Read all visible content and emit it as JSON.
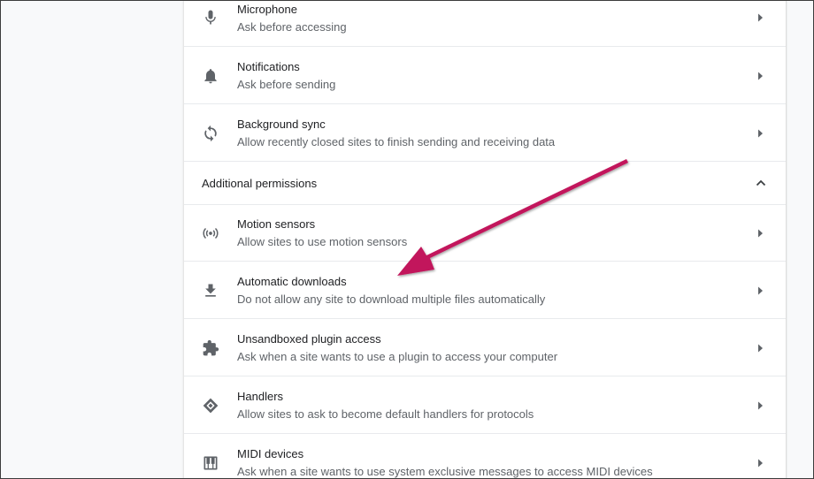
{
  "permissions": {
    "items_top": [
      {
        "key": "microphone",
        "title": "Microphone",
        "subtitle": "Ask before accessing",
        "icon": "microphone-icon"
      },
      {
        "key": "notifications",
        "title": "Notifications",
        "subtitle": "Ask before sending",
        "icon": "bell-icon"
      },
      {
        "key": "background-sync",
        "title": "Background sync",
        "subtitle": "Allow recently closed sites to finish sending and receiving data",
        "icon": "sync-icon"
      }
    ],
    "additional": {
      "label": "Additional permissions",
      "expanded": true,
      "chevron_icon": "chevron-up-icon"
    },
    "items_additional": [
      {
        "key": "motion-sensors",
        "title": "Motion sensors",
        "subtitle": "Allow sites to use motion sensors",
        "icon": "sensors-icon"
      },
      {
        "key": "automatic-downloads",
        "title": "Automatic downloads",
        "subtitle": "Do not allow any site to download multiple files automatically",
        "icon": "download-icon"
      },
      {
        "key": "unsandboxed-plugin",
        "title": "Unsandboxed plugin access",
        "subtitle": "Ask when a site wants to use a plugin to access your computer",
        "icon": "puzzle-icon"
      },
      {
        "key": "handlers",
        "title": "Handlers",
        "subtitle": "Allow sites to ask to become default handlers for protocols",
        "icon": "handlers-icon"
      },
      {
        "key": "midi-devices",
        "title": "MIDI devices",
        "subtitle": "Ask when a site wants to use system exclusive messages to access MIDI devices",
        "icon": "piano-icon"
      }
    ],
    "row_arrow_icon": "chevron-right-icon"
  },
  "annotation": {
    "color": "#c2185b",
    "icon": "annotation-arrow-icon"
  }
}
